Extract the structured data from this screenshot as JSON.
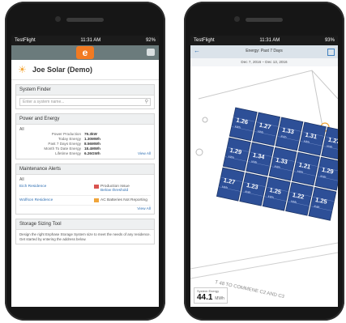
{
  "left": {
    "status": {
      "carrier": "TestFlight",
      "time": "11:31 AM",
      "battery": "92%"
    },
    "site": {
      "title": "Joe Solar (Demo)"
    },
    "system_finder": {
      "title": "System Finder",
      "placeholder": "Enter a system name..."
    },
    "power": {
      "title": "Power and Energy",
      "filter": "All",
      "rows": [
        {
          "label": "Power Production",
          "value": "79.3kW"
        },
        {
          "label": "Today Energy",
          "value": "1.30MWh"
        },
        {
          "label": "Past 7 Days Energy",
          "value": "8.56MWh"
        },
        {
          "label": "Month To Date Energy",
          "value": "18.4MWh"
        },
        {
          "label": "Lifetime Energy",
          "value": "6.26GWh"
        }
      ],
      "view_all": "View All"
    },
    "maintenance": {
      "title": "Maintenance Alerts",
      "filter": "All",
      "rows": [
        {
          "site": "Eich Residence",
          "alert": "Production Issue",
          "detail": "Below threshold"
        },
        {
          "site": "Wolfson Residence",
          "alert": "AC Batteries Not Reporting",
          "detail": ""
        }
      ],
      "view_all": "View All"
    },
    "storage": {
      "title": "Storage Sizing Tool",
      "text": "Design the right Enphase Storage System size to meet the needs of any residence. Get started by entering the address below."
    }
  },
  "right": {
    "status": {
      "carrier": "TestFlight",
      "time": "11:31 AM",
      "battery": "93%"
    },
    "nav_title": "Energy: Past 7 Days",
    "date_range": "Dec 7, 2016 – Dec 13, 2016",
    "road_label": "T 48 TO COMMENE C2 AND C3",
    "energy_label": "System Energy",
    "energy_value": "44.1",
    "energy_unit": "MWh",
    "panels": [
      {
        "value": "1.26",
        "unit": "kWh"
      },
      {
        "value": "1.27",
        "unit": "kWh"
      },
      {
        "value": "1.33",
        "unit": "kWh"
      },
      {
        "value": "1.31",
        "unit": "kWh"
      },
      {
        "value": "1.27",
        "unit": "kWh"
      },
      {
        "value": "1.29",
        "unit": "kWh"
      },
      {
        "value": "1.34",
        "unit": "kWh"
      },
      {
        "value": "1.33",
        "unit": "kWh"
      },
      {
        "value": "1.21",
        "unit": "kWh"
      },
      {
        "value": "1.29",
        "unit": "kWh"
      },
      {
        "value": "1.27",
        "unit": "kWh"
      },
      {
        "value": "1.23",
        "unit": "kWh"
      },
      {
        "value": "1.25",
        "unit": "kWh"
      },
      {
        "value": "1.22",
        "unit": "kWh"
      },
      {
        "value": "1.25",
        "unit": "kWh"
      }
    ],
    "colors": {
      "panel": "#2d4f97",
      "panel_grid": "#8ea6d8",
      "compass": "#f0a53a"
    }
  }
}
